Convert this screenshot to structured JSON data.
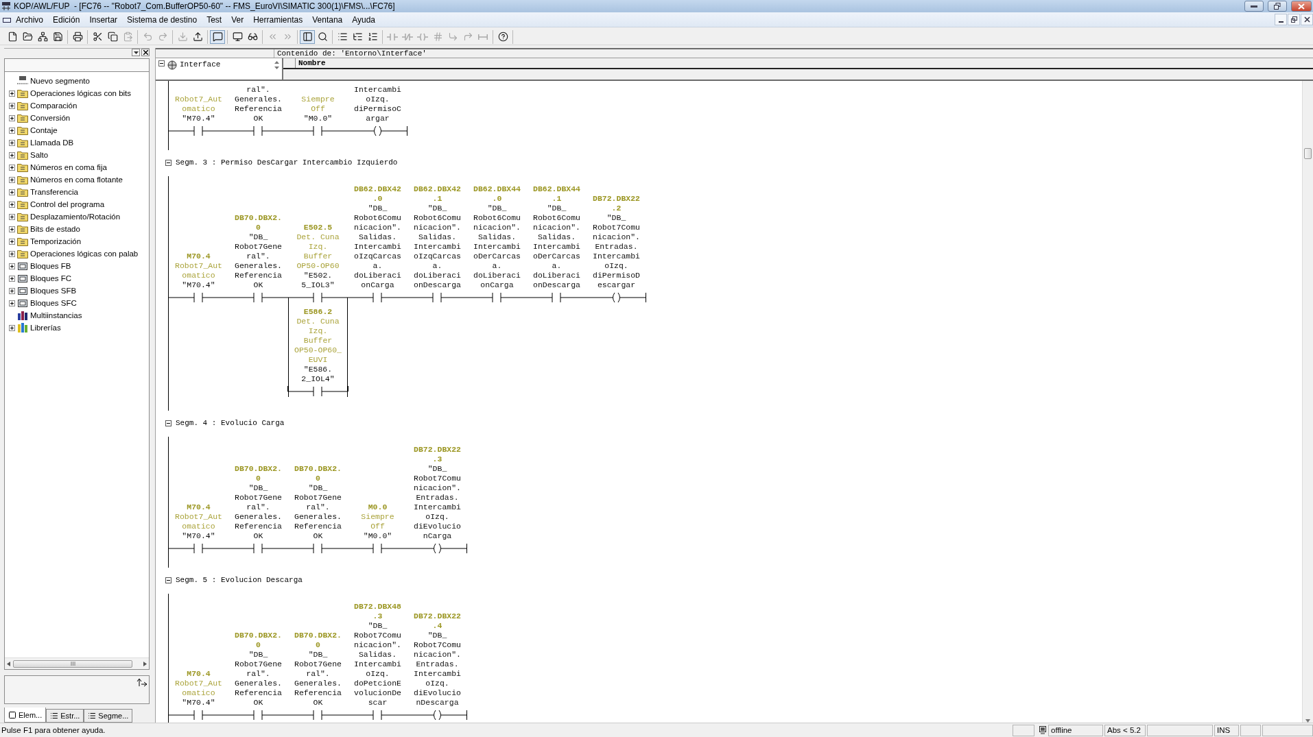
{
  "window": {
    "title": "KOP/AWL/FUP  - [FC76 -- \"Robot7_Com.BufferOP50-60\" -- FMS_EuroVI\\SIMATIC 300(1)\\FMS\\...\\FC76]"
  },
  "menu": [
    "Archivo",
    "Edición",
    "Insertar",
    "Sistema de destino",
    "Test",
    "Ver",
    "Herramientas",
    "Ventana",
    "Ayuda"
  ],
  "toolbar": [
    [
      {
        "disabled": false,
        "pressed": false
      },
      {
        "disabled": false,
        "pressed": false
      },
      {
        "disabled": false,
        "pressed": false
      },
      {
        "disabled": false,
        "pressed": false
      }
    ],
    [
      {
        "disabled": false,
        "pressed": false
      }
    ],
    [
      {
        "disabled": false,
        "pressed": false
      },
      {
        "disabled": false,
        "pressed": false
      },
      {
        "disabled": true,
        "pressed": false
      }
    ],
    [
      {
        "disabled": true,
        "pressed": false
      },
      {
        "disabled": true,
        "pressed": false
      }
    ],
    [
      {
        "disabled": true,
        "pressed": false
      },
      {
        "disabled": false,
        "pressed": false
      }
    ],
    [
      {
        "disabled": false,
        "pressed": true
      }
    ],
    [
      {
        "disabled": false,
        "pressed": false
      },
      {
        "disabled": false,
        "pressed": false
      }
    ],
    [
      {
        "disabled": true,
        "pressed": false
      },
      {
        "disabled": true,
        "pressed": false
      }
    ],
    [
      {
        "disabled": false,
        "pressed": true
      },
      {
        "disabled": false,
        "pressed": false
      }
    ],
    [
      {
        "disabled": false,
        "pressed": false
      },
      {
        "disabled": false,
        "pressed": false
      },
      {
        "disabled": false,
        "pressed": false
      }
    ],
    [
      {
        "disabled": true,
        "pressed": false
      },
      {
        "disabled": true,
        "pressed": false
      },
      {
        "disabled": true,
        "pressed": false
      },
      {
        "disabled": true,
        "pressed": false
      },
      {
        "disabled": true,
        "pressed": false
      },
      {
        "disabled": true,
        "pressed": false
      },
      {
        "disabled": true,
        "pressed": false
      }
    ],
    [
      {
        "disabled": false,
        "pressed": false
      }
    ]
  ],
  "catalog": {
    "items": [
      {
        "label": "Nuevo segmento",
        "kind": "segment"
      },
      {
        "label": "Operaciones lógicas con bits",
        "kind": "folder",
        "expanded": false
      },
      {
        "label": "Comparación",
        "kind": "folder",
        "expanded": false
      },
      {
        "label": "Conversión",
        "kind": "folder",
        "expanded": false
      },
      {
        "label": "Contaje",
        "kind": "folder",
        "expanded": false
      },
      {
        "label": "Llamada DB",
        "kind": "folder",
        "expanded": false
      },
      {
        "label": "Salto",
        "kind": "folder",
        "expanded": false
      },
      {
        "label": "Números en coma fija",
        "kind": "folder",
        "expanded": false
      },
      {
        "label": "Números en coma flotante",
        "kind": "folder",
        "expanded": false
      },
      {
        "label": "Transferencia",
        "kind": "folder",
        "expanded": false
      },
      {
        "label": "Control del programa",
        "kind": "folder",
        "expanded": false
      },
      {
        "label": "Desplazamiento/Rotación",
        "kind": "folder",
        "expanded": false
      },
      {
        "label": "Bits de estado",
        "kind": "folder",
        "expanded": false
      },
      {
        "label": "Temporización",
        "kind": "folder",
        "expanded": false
      },
      {
        "label": "Operaciones lógicas con palab",
        "kind": "folder",
        "expanded": false
      },
      {
        "label": "Bloques FB",
        "kind": "block",
        "expanded": false
      },
      {
        "label": "Bloques FC",
        "kind": "block",
        "expanded": false
      },
      {
        "label": "Bloques SFB",
        "kind": "block",
        "expanded": false
      },
      {
        "label": "Bloques SFC",
        "kind": "block",
        "expanded": false
      },
      {
        "label": "Multiinstancias",
        "kind": "multi"
      },
      {
        "label": "Librerías",
        "kind": "library",
        "expanded": false
      }
    ],
    "tabs": [
      {
        "label": "Elem...",
        "selected": true
      },
      {
        "label": "Estr...",
        "selected": false
      },
      {
        "label": "Segme...",
        "selected": false
      }
    ]
  },
  "interface": {
    "caption": "Contenido de: 'Entorno\\Interface'",
    "root": "Interface",
    "expanded": true,
    "column": "Nombre"
  },
  "segments": [
    {
      "elements": [
        {
          "kind": "contact",
          "comment": "Robot7_Aut\nomatico",
          "operand": "\"M70.4\""
        },
        {
          "kind": "contact",
          "operand": "ral\".\nGenerales.\nReferencia\nOK"
        },
        {
          "kind": "contact",
          "comment": "Siempre\nOff",
          "operand": "\"M0.0\""
        },
        {
          "kind": "coil",
          "operand": "Intercambi\noIzq.\ndiPermisoC\nargar"
        }
      ]
    },
    {
      "heading": "Segm. 3 : Permiso DesCargar Intercambio Izquierdo",
      "expanded": true,
      "elements": [
        {
          "kind": "contact",
          "address": "M70.4",
          "comment": "Robot7_Aut\nomatico",
          "operand": "\"M70.4\""
        },
        {
          "kind": "contact",
          "address": "DB70.DBX2.\n0",
          "operand": "\"DB_\nRobot7Gene\nral\".\nGenerales.\nReferencia\nOK"
        },
        {
          "kind": "contact",
          "address": "E502.5",
          "comment": "Det. Cuna\nIzq.\nBuffer\nOP50-OP60",
          "operand": "\"E502.\n5_IOL3\"",
          "parallel": {
            "kind": "contact",
            "address": "E586.2",
            "comment": "Det. Cuna\nIzq.\nBuffer\nOP50-OP60_\nEUVI",
            "operand": "\"E586.\n2_IOL4\""
          }
        },
        {
          "kind": "contact",
          "address": "DB62.DBX42\n.0",
          "operand": "\"DB_\nRobot6Comu\nnicacion\".\nSalidas.\nIntercambi\noIzqCarcas\na.\ndoLiberaci\nonCarga"
        },
        {
          "kind": "contact",
          "address": "DB62.DBX42\n.1",
          "operand": "\"DB_\nRobot6Comu\nnicacion\".\nSalidas.\nIntercambi\noIzqCarcas\na.\ndoLiberaci\nonDescarga"
        },
        {
          "kind": "contact",
          "address": "DB62.DBX44\n.0",
          "operand": "\"DB_\nRobot6Comu\nnicacion\".\nSalidas.\nIntercambi\noDerCarcas\na.\ndoLiberaci\nonCarga"
        },
        {
          "kind": "contact",
          "address": "DB62.DBX44\n.1",
          "operand": "\"DB_\nRobot6Comu\nnicacion\".\nSalidas.\nIntercambi\noDerCarcas\na.\ndoLiberaci\nonDescarga"
        },
        {
          "kind": "coil",
          "address": "DB72.DBX22\n.2",
          "operand": "\"DB_\nRobot7Comu\nnicacion\".\nEntradas.\nIntercambi\noIzq.\ndiPermisoD\nescargar"
        }
      ]
    },
    {
      "heading": "Segm. 4 : Evolucio Carga",
      "expanded": true,
      "elements": [
        {
          "kind": "contact",
          "address": "M70.4",
          "comment": "Robot7_Aut\nomatico",
          "operand": "\"M70.4\""
        },
        {
          "kind": "contact",
          "address": "DB70.DBX2.\n0",
          "operand": "\"DB_\nRobot7Gene\nral\".\nGenerales.\nReferencia\nOK"
        },
        {
          "kind": "contact",
          "address": "DB70.DBX2.\n0",
          "operand": "\"DB_\nRobot7Gene\nral\".\nGenerales.\nReferencia\nOK"
        },
        {
          "kind": "contact",
          "address": "M0.0",
          "comment": "Siempre\nOff",
          "operand": "\"M0.0\""
        },
        {
          "kind": "coil",
          "address": "DB72.DBX22\n.3",
          "operand": "\"DB_\nRobot7Comu\nnicacion\".\nEntradas.\nIntercambi\noIzq.\ndiEvolucio\nnCarga"
        }
      ]
    },
    {
      "heading": "Segm. 5 : Evolucion Descarga",
      "expanded": true,
      "elements": [
        {
          "kind": "contact",
          "address": "M70.4",
          "comment": "Robot7_Aut\nomatico",
          "operand": "\"M70.4\""
        },
        {
          "kind": "contact",
          "address": "DB70.DBX2.\n0",
          "operand": "\"DB_\nRobot7Gene\nral\".\nGenerales.\nReferencia\nOK"
        },
        {
          "kind": "contact",
          "address": "DB70.DBX2.\n0",
          "operand": "\"DB_\nRobot7Gene\nral\".\nGenerales.\nReferencia\nOK"
        },
        {
          "kind": "contact",
          "address": "DB72.DBX48\n.3",
          "operand": "\"DB_\nRobot7Comu\nnicacion\".\nSalidas.\nIntercambi\noIzq.\ndoPetcionE\nvolucionDe\nscar"
        },
        {
          "kind": "coil",
          "address": "DB72.DBX22\n.4",
          "operand": "\"DB_\nRobot7Comu\nnicacion\".\nEntradas.\nIntercambi\noIzq.\ndiEvolucio\nnDescarga"
        }
      ]
    }
  ],
  "status": {
    "help": "Pulse F1 para obtener ayuda.",
    "panes": [
      {
        "kind": "blank"
      },
      {
        "kind": "connection",
        "text": "offline"
      },
      {
        "kind": "text",
        "text": "Abs < 5.2"
      },
      {
        "kind": "blank"
      },
      {
        "kind": "text",
        "text": "INS"
      },
      {
        "kind": "blank"
      },
      {
        "kind": "blank"
      }
    ]
  }
}
